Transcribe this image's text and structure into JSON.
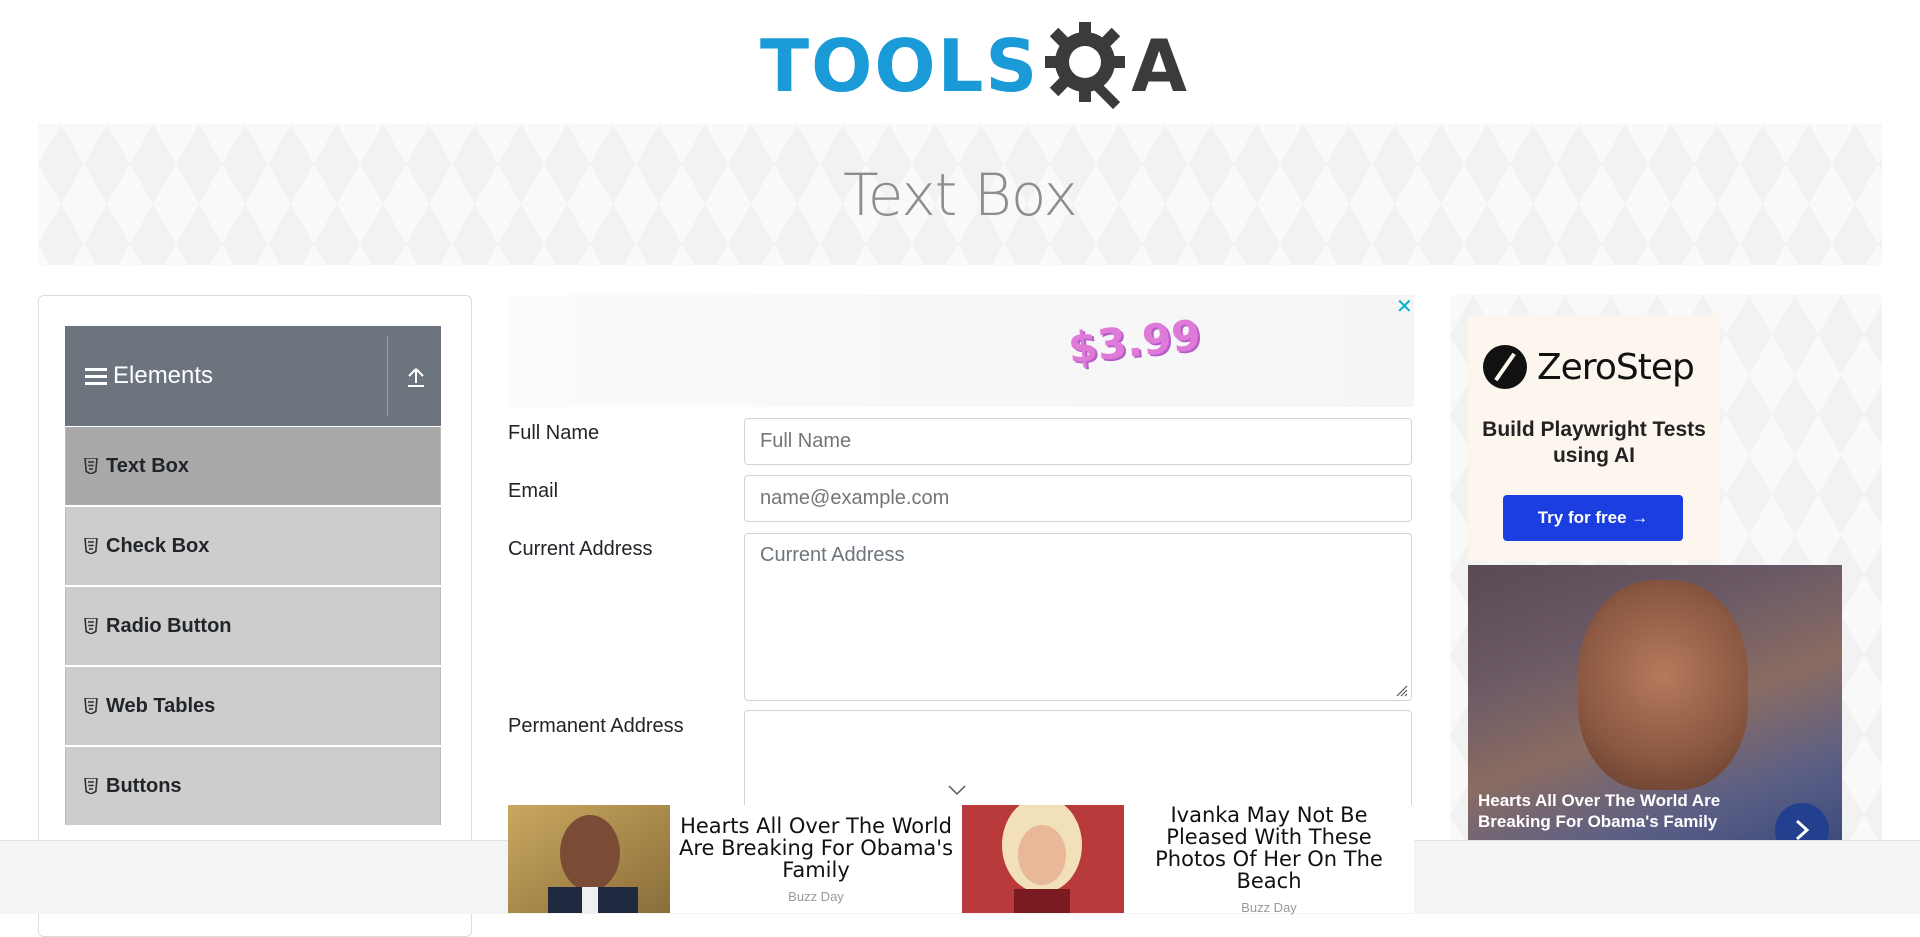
{
  "logo": {
    "part1": "TOOLS",
    "part2": "A"
  },
  "banner": {
    "title": "Text Box"
  },
  "sidebar": {
    "group_title": "Elements",
    "items": [
      {
        "label": "Text Box"
      },
      {
        "label": "Check Box"
      },
      {
        "label": "Radio Button"
      },
      {
        "label": "Web Tables"
      },
      {
        "label": "Buttons"
      }
    ]
  },
  "top_ad": {
    "price": "$3.99",
    "close": "✕"
  },
  "form": {
    "full_name": {
      "label": "Full Name",
      "placeholder": "Full Name"
    },
    "email": {
      "label": "Email",
      "placeholder": "name@example.com"
    },
    "current_address": {
      "label": "Current Address",
      "placeholder": "Current Address"
    },
    "permanent_address": {
      "label": "Permanent Address",
      "placeholder": ""
    }
  },
  "right_ad": {
    "brand": "ZeroStep",
    "tagline": "Build Playwright Tests using AI",
    "cta": "Try for free →",
    "caption": "Hearts All Over The World Are Breaking For Obama's Family"
  },
  "bottom_ads": [
    {
      "headline": "Hearts All Over The World Are Breaking For Obama's Family",
      "source": "Buzz Day"
    },
    {
      "headline": "Ivanka May Not Be Pleased With These Photos Of Her On The Beach",
      "source": "Buzz Day"
    }
  ],
  "colors": {
    "brand_blue": "#1a9bd7",
    "sidebar_header": "#6c757d",
    "cta_blue": "#1a3ee0"
  }
}
